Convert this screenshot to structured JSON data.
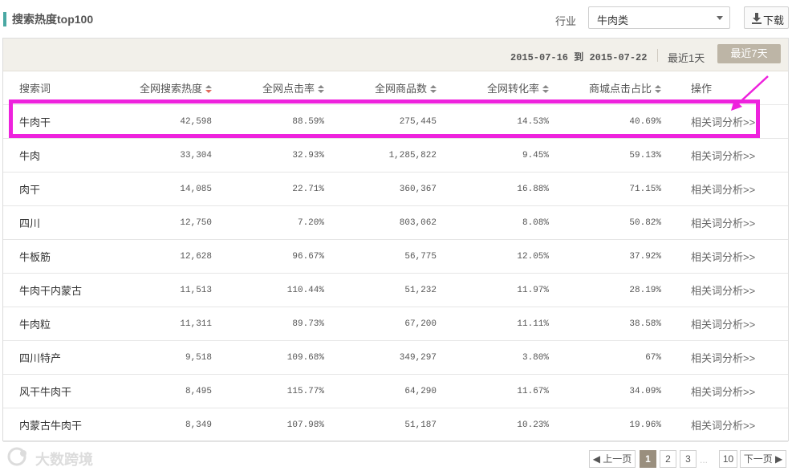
{
  "header": {
    "title": "搜索热度top100",
    "industry_label": "行业",
    "industry_value": "牛肉类",
    "download_label": "下载"
  },
  "panel": {
    "date_from": "2015-07-16",
    "date_to_word": "到",
    "date_to": "2015-07-22",
    "range_1d": "最近1天",
    "range_7d": "最近7天"
  },
  "table": {
    "columns": [
      "搜索词",
      "全网搜索热度",
      "全网点击率",
      "全网商品数",
      "全网转化率",
      "商城点击占比",
      "操作"
    ],
    "rows": [
      {
        "keyword": "牛肉干",
        "heat": "42,598",
        "ctr": "88.59%",
        "items": "275,445",
        "cvr": "14.53%",
        "mall": "40.69%",
        "action": "相关词分析>>"
      },
      {
        "keyword": "牛肉",
        "heat": "33,304",
        "ctr": "32.93%",
        "items": "1,285,822",
        "cvr": "9.45%",
        "mall": "59.13%",
        "action": "相关词分析>>"
      },
      {
        "keyword": "肉干",
        "heat": "14,085",
        "ctr": "22.71%",
        "items": "360,367",
        "cvr": "16.88%",
        "mall": "71.15%",
        "action": "相关词分析>>"
      },
      {
        "keyword": "四川",
        "heat": "12,750",
        "ctr": "7.20%",
        "items": "803,062",
        "cvr": "8.08%",
        "mall": "50.82%",
        "action": "相关词分析>>"
      },
      {
        "keyword": "牛板筋",
        "heat": "12,628",
        "ctr": "96.67%",
        "items": "56,775",
        "cvr": "12.05%",
        "mall": "37.92%",
        "action": "相关词分析>>"
      },
      {
        "keyword": "牛肉干内蒙古",
        "heat": "11,513",
        "ctr": "110.44%",
        "items": "51,232",
        "cvr": "11.97%",
        "mall": "28.19%",
        "action": "相关词分析>>"
      },
      {
        "keyword": "牛肉粒",
        "heat": "11,311",
        "ctr": "89.73%",
        "items": "67,200",
        "cvr": "11.11%",
        "mall": "38.58%",
        "action": "相关词分析>>"
      },
      {
        "keyword": "四川特产",
        "heat": "9,518",
        "ctr": "109.68%",
        "items": "349,297",
        "cvr": "3.80%",
        "mall": "67%",
        "action": "相关词分析>>"
      },
      {
        "keyword": "风干牛肉干",
        "heat": "8,495",
        "ctr": "115.77%",
        "items": "64,290",
        "cvr": "11.67%",
        "mall": "34.09%",
        "action": "相关词分析>>"
      },
      {
        "keyword": "内蒙古牛肉干",
        "heat": "8,349",
        "ctr": "107.98%",
        "items": "51,187",
        "cvr": "10.23%",
        "mall": "19.96%",
        "action": "相关词分析>>"
      }
    ]
  },
  "watermark": "大数跨境",
  "pagination": {
    "prev": "上一页",
    "pages": [
      "1",
      "2",
      "3"
    ],
    "ellipsis": "...",
    "last": "10",
    "next": "下一页",
    "current": "1"
  },
  "colors": {
    "accent": "#4aa8a3",
    "highlight": "#ee22dd",
    "active_range": "#bdb5a6",
    "current_page": "#9a8f7e"
  }
}
